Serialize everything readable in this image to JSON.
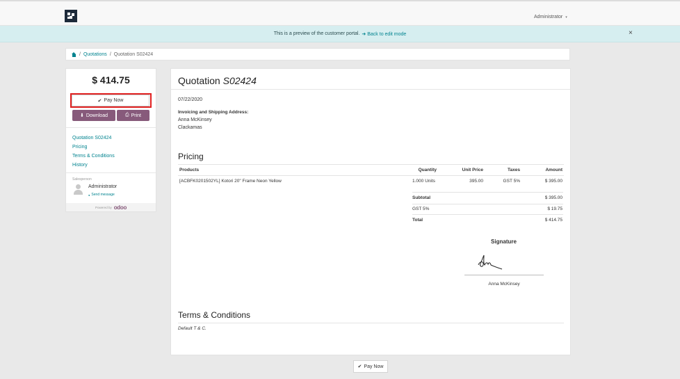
{
  "header": {
    "user_menu_label": "Administrator",
    "user_menu_caret": "▾"
  },
  "banner": {
    "text": "This is a preview of the customer portal.",
    "link_label": "Back to edit mode",
    "close_glyph": "×"
  },
  "breadcrumb": {
    "separator": "/",
    "items": [
      "Quotations",
      "Quotation S02424"
    ]
  },
  "sidebar": {
    "amount": "$ 414.75",
    "pay_now_label": "Pay Now",
    "download_label": "Download",
    "print_label": "Print",
    "nav": [
      "Quotation S02424",
      "Pricing",
      "Terms & Conditions",
      "History"
    ],
    "salesperson_label": "Salesperson",
    "salesperson_name": "Administrator",
    "send_message_label": "Send message",
    "powered_by_label": "Powered by",
    "brand": "odoo"
  },
  "document": {
    "title_prefix": "Quotation",
    "title_number": "S02424",
    "date": "07/22/2020",
    "address_label": "Invoicing and Shipping Address:",
    "address_lines": [
      "Anna McKinsey",
      "Clackamas"
    ],
    "pricing_heading": "Pricing",
    "table": {
      "headers": [
        "Products",
        "Quantity",
        "Unit Price",
        "Taxes",
        "Amount"
      ],
      "rows": [
        [
          "[ACBFK0201502YL] Kotori 20\" Frame Neon Yellow",
          "1.000 Units",
          "395.00",
          "GST 5%",
          "$ 395.00"
        ]
      ]
    },
    "totals": [
      {
        "label": "Subtotal",
        "value": "$ 395.00"
      },
      {
        "label": "GST 5%",
        "value": "$ 19.75"
      },
      {
        "label": "Total",
        "value": "$ 414.75"
      }
    ],
    "signature_heading": "Signature",
    "signer_name": "Anna McKinsey",
    "terms_heading": "Terms & Conditions",
    "terms_text": "Default T & C."
  },
  "footer": {
    "pay_now_label": "Pay Now"
  },
  "icons": {
    "check": "✔",
    "download": "⬇",
    "print": "⎙",
    "arrow": "➜",
    "chat": "💬"
  },
  "colors": {
    "accent": "#00838f",
    "primary_button": "#875a7b",
    "banner_bg": "#d6eef0",
    "highlight": "#e02020"
  }
}
